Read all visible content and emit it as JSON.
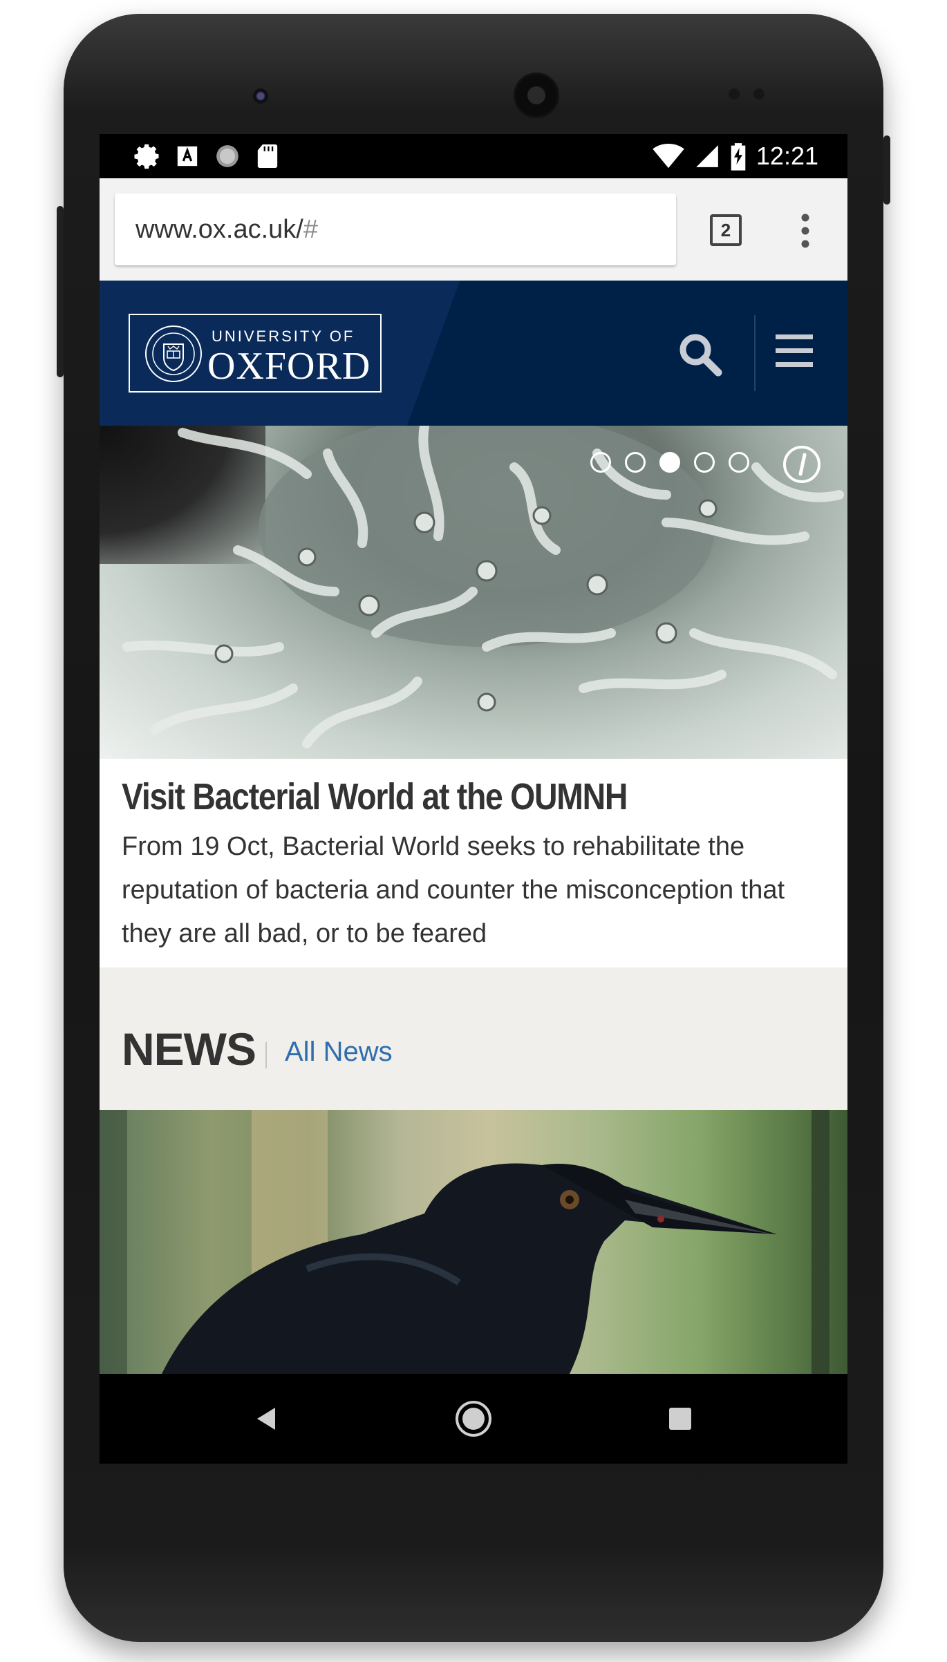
{
  "status_bar": {
    "time": "12:21",
    "left_icons": [
      "settings-icon",
      "text-a-icon",
      "sync-spinner-icon",
      "sd-card-icon"
    ],
    "right_icons": [
      "wifi-icon",
      "signal-icon",
      "battery-charging-icon"
    ]
  },
  "browser": {
    "url_host": "www.ox.ac.uk/",
    "url_hash": "#",
    "tab_count": "2"
  },
  "site_header": {
    "logo_small": "UNIVERSITY OF",
    "logo_large": "OXFORD",
    "icons": [
      "search-icon",
      "hamburger-menu-icon"
    ],
    "colors": {
      "navy": "#002147",
      "link_blue": "#2f6eac"
    }
  },
  "carousel": {
    "slide_count": 5,
    "active_index": 2,
    "title": "Visit Bacterial World at the OUMNH",
    "body": "From 19 Oct, Bacterial World seeks to rehabilitate the reputation of bacteria and counter the misconception that they are all bad, or to be feared"
  },
  "news": {
    "heading": "NEWS",
    "link": "All News"
  },
  "nav_bar": {
    "icons": [
      "back-icon",
      "home-icon",
      "recents-icon"
    ]
  }
}
